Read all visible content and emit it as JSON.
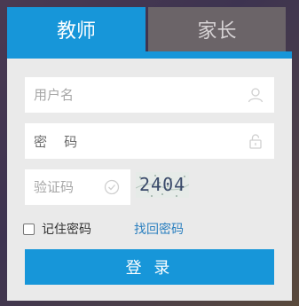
{
  "tabs": {
    "teacher": "教师",
    "parent": "家长"
  },
  "form": {
    "username_placeholder": "用户名",
    "password_label_1": "密",
    "password_label_2": "码",
    "captcha_placeholder": "验证码",
    "captcha_image_text": "2404",
    "remember_label": "记住密码",
    "forgot_link": "找回密码",
    "login_button": "登 录"
  },
  "colors": {
    "accent": "#1796d9",
    "inactive_tab": "#6b6468",
    "panel": "#eaeaea",
    "link": "#2a7fbf"
  },
  "icons": {
    "username": "user-icon",
    "password": "lock-icon",
    "captcha": "check-circle-icon"
  }
}
